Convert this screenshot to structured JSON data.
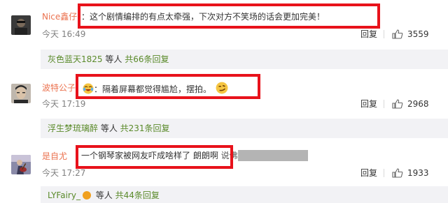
{
  "colors": {
    "highlight": "#e8121b",
    "username": "#eb7350",
    "reply_user": "#5a8a2a"
  },
  "comments": [
    {
      "avatar": "avatar-dark-figure",
      "user": "Nice鑫仔",
      "text": "：这个剧情编排的有点太牵强，下次对方不笑场的话会更加完美！",
      "time": "今天 16:49",
      "reply_label": "回复",
      "likes": "3559",
      "replies": {
        "user": "灰色蓝天1825",
        "rest": " 等人 ",
        "count": "共66条回复"
      }
    },
    {
      "avatar": "avatar-face-portrait",
      "user": "波特公子",
      "emoji_before": "crying-laugh-emoji",
      "text": "：隔着屏幕都觉得尴尬，摆拍。",
      "emoji_after": "smirk-emoji",
      "time": "今天 17:19",
      "reply_label": "回复",
      "likes": "2968",
      "replies": {
        "user": "浮生梦琉璃醉",
        "rest": " 等人 ",
        "count": "共231条回复"
      }
    },
    {
      "avatar": "avatar-guitar-player",
      "user": "是自尤",
      "text": "一个钢琴家被网友吓成啥样了 朗朗啊",
      "text_partial": "说佛",
      "time": "今天 17:27",
      "reply_label": "回复",
      "likes": "1933",
      "replies": {
        "user": "LYFairy_",
        "rest": " 等人 ",
        "count": "共44条回复"
      }
    }
  ]
}
